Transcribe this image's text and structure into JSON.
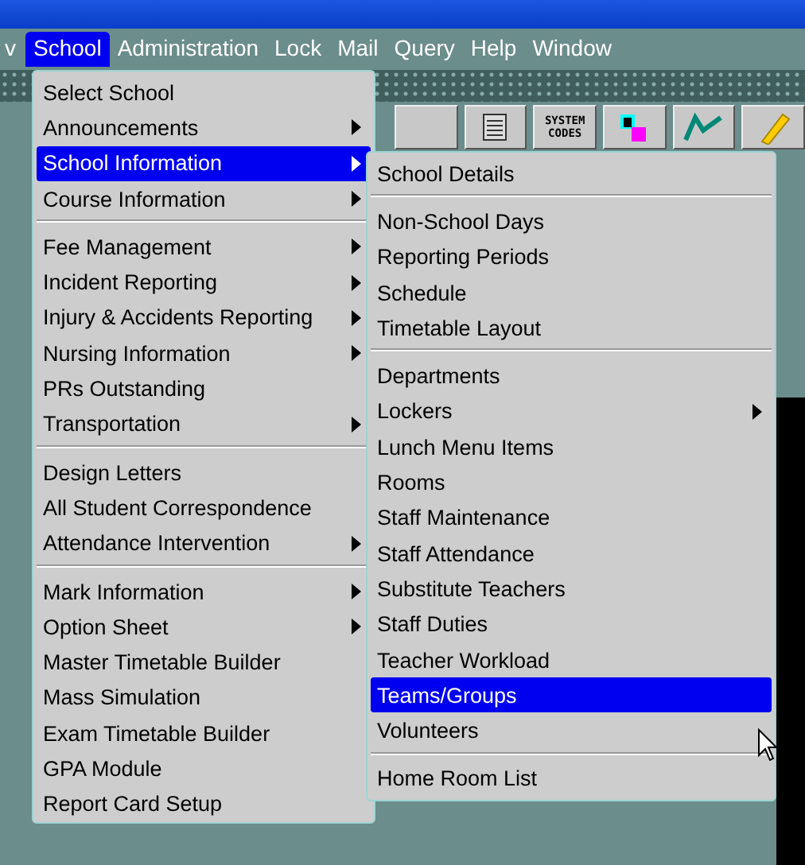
{
  "menubar": {
    "items": [
      {
        "label": "v",
        "selected": false
      },
      {
        "label": "School",
        "selected": true
      },
      {
        "label": "Administration",
        "selected": false
      },
      {
        "label": "Lock",
        "selected": false
      },
      {
        "label": "Mail",
        "selected": false
      },
      {
        "label": "Query",
        "selected": false
      },
      {
        "label": "Help",
        "selected": false
      },
      {
        "label": "Window",
        "selected": false
      }
    ]
  },
  "toolbar": {
    "system_codes_label": "SYSTEM CODES"
  },
  "school_menu": {
    "groups": [
      [
        {
          "label": "Select School",
          "has_submenu": false,
          "selected": false
        },
        {
          "label": "Announcements",
          "has_submenu": true,
          "selected": false
        },
        {
          "label": "School Information",
          "has_submenu": true,
          "selected": true
        },
        {
          "label": "Course Information",
          "has_submenu": true,
          "selected": false
        }
      ],
      [
        {
          "label": "Fee Management",
          "has_submenu": true,
          "selected": false
        },
        {
          "label": "Incident Reporting",
          "has_submenu": true,
          "selected": false
        },
        {
          "label": "Injury & Accidents Reporting",
          "has_submenu": true,
          "selected": false
        },
        {
          "label": "Nursing Information",
          "has_submenu": true,
          "selected": false
        },
        {
          "label": "PRs Outstanding",
          "has_submenu": false,
          "selected": false
        },
        {
          "label": "Transportation",
          "has_submenu": true,
          "selected": false
        }
      ],
      [
        {
          "label": "Design Letters",
          "has_submenu": false,
          "selected": false
        },
        {
          "label": "All Student Correspondence",
          "has_submenu": false,
          "selected": false
        },
        {
          "label": "Attendance Intervention",
          "has_submenu": true,
          "selected": false
        }
      ],
      [
        {
          "label": "Mark Information",
          "has_submenu": true,
          "selected": false
        },
        {
          "label": "Option Sheet",
          "has_submenu": true,
          "selected": false
        },
        {
          "label": "Master Timetable Builder",
          "has_submenu": false,
          "selected": false
        },
        {
          "label": "Mass Simulation",
          "has_submenu": false,
          "selected": false
        },
        {
          "label": "Exam Timetable Builder",
          "has_submenu": false,
          "selected": false
        },
        {
          "label": "GPA Module",
          "has_submenu": false,
          "selected": false
        },
        {
          "label": "Report Card Setup",
          "has_submenu": false,
          "selected": false
        }
      ]
    ]
  },
  "submenu": {
    "groups": [
      [
        {
          "label": "School Details",
          "has_submenu": false,
          "selected": false
        }
      ],
      [
        {
          "label": "Non-School Days",
          "has_submenu": false,
          "selected": false
        },
        {
          "label": "Reporting Periods",
          "has_submenu": false,
          "selected": false
        },
        {
          "label": "Schedule",
          "has_submenu": false,
          "selected": false
        },
        {
          "label": "Timetable Layout",
          "has_submenu": false,
          "selected": false
        }
      ],
      [
        {
          "label": "Departments",
          "has_submenu": false,
          "selected": false
        },
        {
          "label": "Lockers",
          "has_submenu": true,
          "selected": false
        },
        {
          "label": "Lunch Menu Items",
          "has_submenu": false,
          "selected": false
        },
        {
          "label": "Rooms",
          "has_submenu": false,
          "selected": false
        },
        {
          "label": "Staff Maintenance",
          "has_submenu": false,
          "selected": false
        },
        {
          "label": "Staff Attendance",
          "has_submenu": false,
          "selected": false
        },
        {
          "label": "Substitute Teachers",
          "has_submenu": false,
          "selected": false
        },
        {
          "label": "Staff Duties",
          "has_submenu": false,
          "selected": false
        },
        {
          "label": "Teacher Workload",
          "has_submenu": false,
          "selected": false
        },
        {
          "label": "Teams/Groups",
          "has_submenu": false,
          "selected": true
        },
        {
          "label": "Volunteers",
          "has_submenu": false,
          "selected": false
        }
      ],
      [
        {
          "label": "Home Room List",
          "has_submenu": false,
          "selected": false
        }
      ]
    ]
  }
}
